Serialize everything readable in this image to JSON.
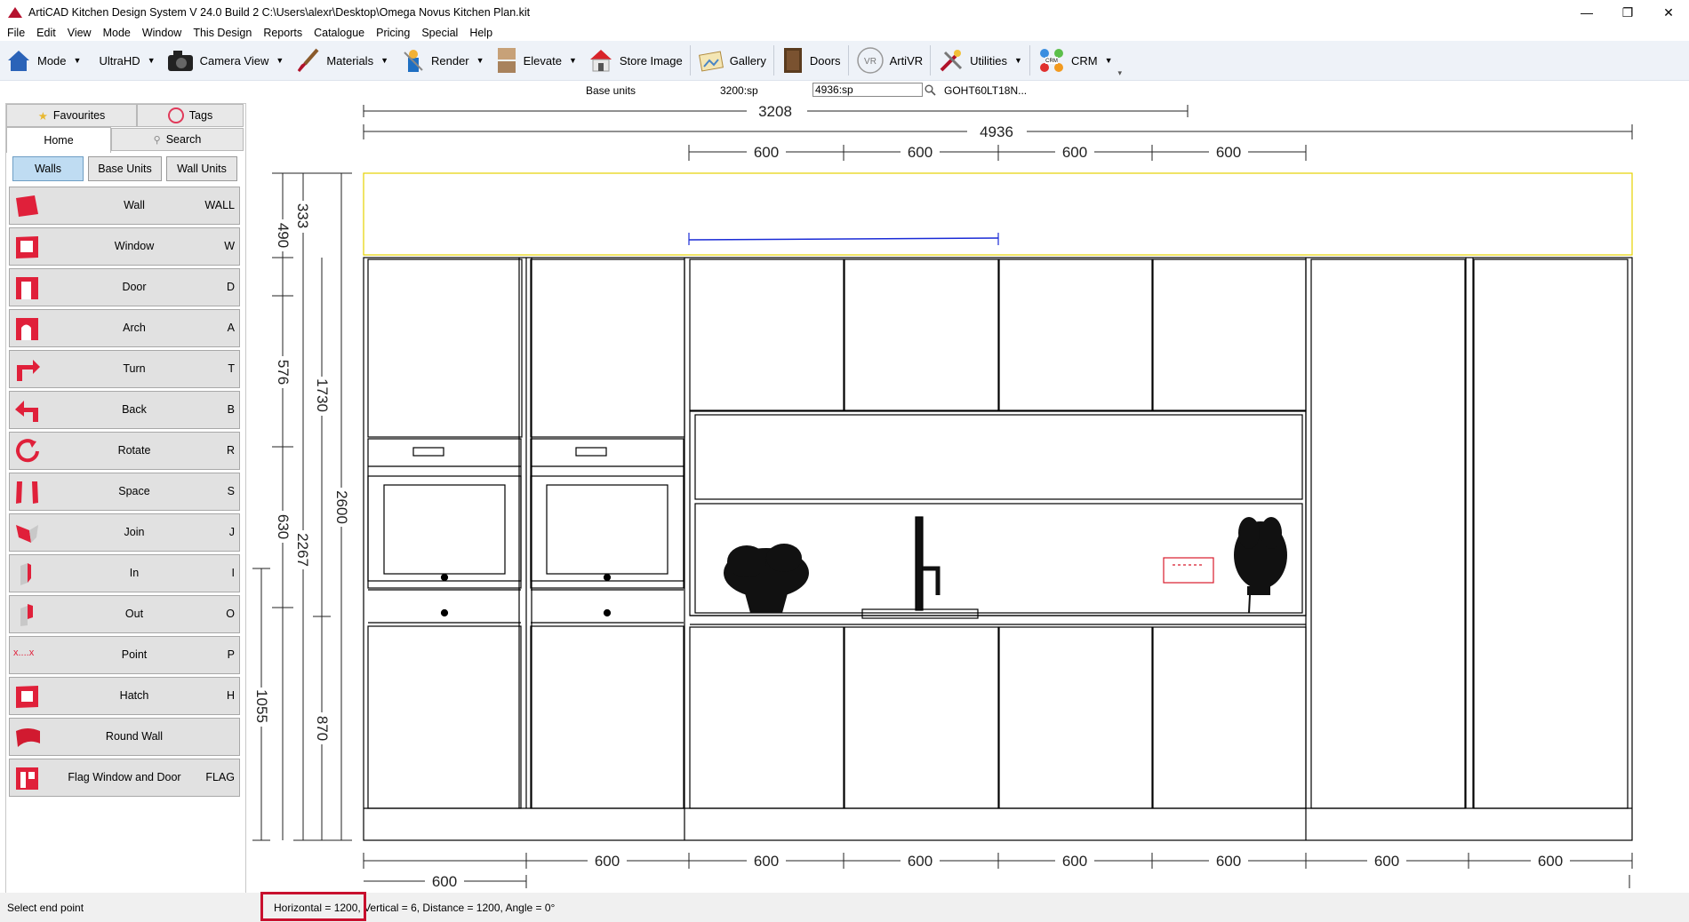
{
  "window": {
    "title": "ArtiCAD Kitchen Design System  V 24.0 Build 2   C:\\Users\\alexr\\Desktop\\Omega Novus Kitchen Plan.kit",
    "minimize": "—",
    "restore": "❐",
    "close": "✕"
  },
  "menu": [
    "File",
    "Edit",
    "View",
    "Mode",
    "Window",
    "This Design",
    "Reports",
    "Catalogue",
    "Pricing",
    "Special",
    "Help"
  ],
  "toolbar": {
    "mode": "Mode",
    "quality": "UltraHD",
    "camera": "Camera View",
    "materials": "Materials",
    "render": "Render",
    "elevate": "Elevate",
    "store_image": "Store Image",
    "gallery": "Gallery",
    "doors": "Doors",
    "artivr": "ArtiVR",
    "vr_badge": "VR",
    "utilities": "Utilities",
    "crm": "CRM",
    "crm_badge": "CRM"
  },
  "info": {
    "label": "Base units",
    "value": "3200:sp",
    "input": "4936:sp",
    "code": "GOHT60LT18N..."
  },
  "left_panel": {
    "tabs": {
      "favourites": "Favourites",
      "tags": "Tags",
      "home": "Home",
      "search": "Search"
    },
    "subtabs": {
      "walls": "Walls",
      "base_units": "Base Units",
      "wall_units": "Wall Units"
    },
    "tools": [
      {
        "label": "Wall",
        "key": "WALL"
      },
      {
        "label": "Window",
        "key": "W"
      },
      {
        "label": "Door",
        "key": "D"
      },
      {
        "label": "Arch",
        "key": "A"
      },
      {
        "label": "Turn",
        "key": "T"
      },
      {
        "label": "Back",
        "key": "B"
      },
      {
        "label": "Rotate",
        "key": "R"
      },
      {
        "label": "Space",
        "key": "S"
      },
      {
        "label": "Join",
        "key": "J"
      },
      {
        "label": "In",
        "key": "I"
      },
      {
        "label": "Out",
        "key": "O"
      },
      {
        "label": "Point",
        "key": "P"
      },
      {
        "label": "Hatch",
        "key": "H"
      },
      {
        "label": "Round Wall",
        "key": ""
      },
      {
        "label": "Flag Window and Door",
        "key": "FLAG"
      }
    ],
    "point_glyph": "x....x"
  },
  "drawing": {
    "top_dims": {
      "overall_a": "3208",
      "overall_b": "4936",
      "upper": [
        "600",
        "600",
        "600",
        "600"
      ]
    },
    "left_dims": {
      "d333": "333",
      "d490": "490",
      "d576": "576",
      "d630": "630",
      "d1055": "1055",
      "d1730": "1730",
      "d2267": "2267",
      "d2600": "2600",
      "d870": "870"
    },
    "bottom_dims": [
      "600",
      "600",
      "600",
      "600",
      "600",
      "600",
      "600"
    ],
    "bottom_low": "600",
    "cornice_color": "#e6d200",
    "socket_color": "#d81b2c",
    "dim_line_color": "#1a2bd6"
  },
  "status": {
    "prompt": "Select end point",
    "readout": "Horizontal = 1200, Vertical = 6, Distance = 1200, Angle = 0°",
    "highlight_color": "#c8102e"
  },
  "icons": {
    "wall_tool_color": "#e0203a"
  }
}
